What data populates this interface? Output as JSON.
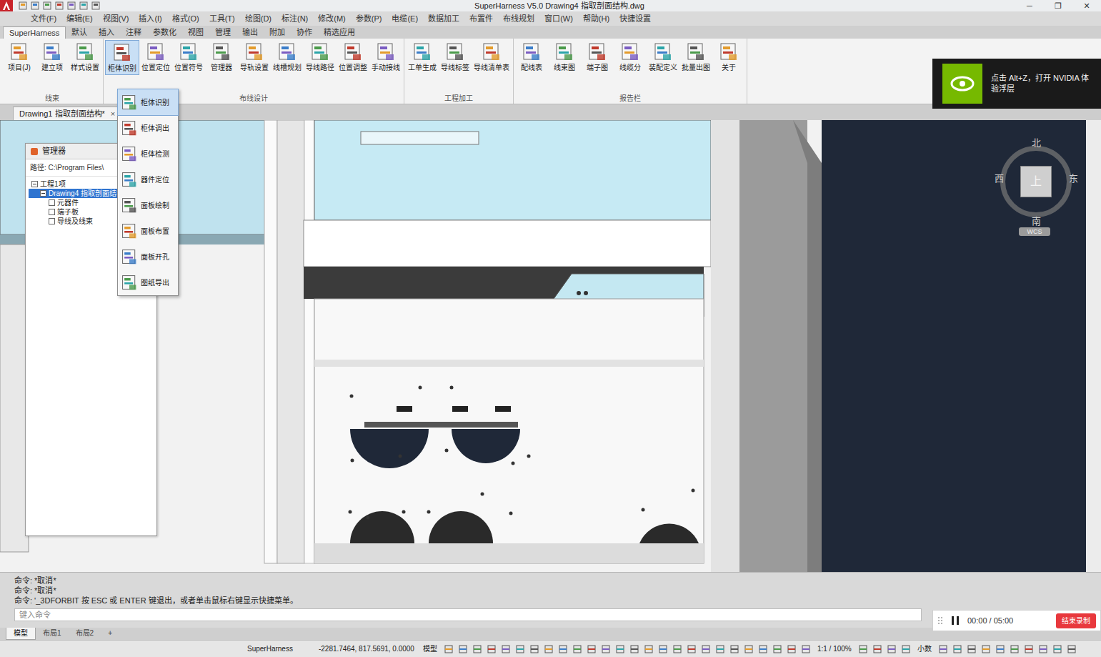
{
  "window": {
    "title": "SuperHarness V5.0   Drawing4 指取剖面结构.dwg",
    "controls": [
      "─",
      "❐",
      "✕"
    ]
  },
  "menu_bar": [
    "文件(F)",
    "编辑(E)",
    "视图(V)",
    "插入(I)",
    "格式(O)",
    "工具(T)",
    "绘图(D)",
    "标注(N)",
    "修改(M)",
    "参数(P)",
    "电缆(E)",
    "数据加工",
    "布置件",
    "布线规划",
    "窗口(W)",
    "帮助(H)",
    "快捷设置"
  ],
  "ribbon_tabs": [
    {
      "label": "SuperHarness",
      "selected": true
    },
    {
      "label": "默认",
      "selected": false
    },
    {
      "label": "插入",
      "selected": false
    },
    {
      "label": "注释",
      "selected": false
    },
    {
      "label": "参数化",
      "selected": false
    },
    {
      "label": "视图",
      "selected": false
    },
    {
      "label": "管理",
      "selected": false
    },
    {
      "label": "输出",
      "selected": false
    },
    {
      "label": "附加",
      "selected": false
    },
    {
      "label": "协作",
      "selected": false
    },
    {
      "label": "精选应用",
      "selected": false
    }
  ],
  "ribbon_groups": [
    {
      "label": "线束",
      "buttons": [
        {
          "label": "项目(J)",
          "selected": false
        },
        {
          "label": "建立项",
          "selected": false
        },
        {
          "label": "样式设置",
          "selected": false
        }
      ]
    },
    {
      "label": "布线设计",
      "buttons": [
        {
          "label": "柜体识别",
          "selected": true
        },
        {
          "label": "位置定位",
          "selected": false
        },
        {
          "label": "位置符号",
          "selected": false
        },
        {
          "label": "管理器",
          "selected": false
        },
        {
          "label": "导轨设置",
          "selected": false
        },
        {
          "label": "线槽规划",
          "selected": false
        },
        {
          "label": "导线路径",
          "selected": false
        },
        {
          "label": "位置调整",
          "selected": false
        },
        {
          "label": "手动接线",
          "selected": false
        }
      ]
    },
    {
      "label": "工程加工",
      "buttons": [
        {
          "label": "工单生成",
          "selected": false
        },
        {
          "label": "导线标签",
          "selected": false
        },
        {
          "label": "导线清单表",
          "selected": false
        }
      ]
    },
    {
      "label": "报告栏",
      "buttons": [
        {
          "label": "配线表",
          "selected": false
        },
        {
          "label": "线束图",
          "selected": false
        },
        {
          "label": "端子图",
          "selected": false
        },
        {
          "label": "线缆分",
          "selected": false
        },
        {
          "label": "装配定义",
          "selected": false
        },
        {
          "label": "批量出图",
          "selected": false
        },
        {
          "label": "关于",
          "selected": false
        }
      ]
    }
  ],
  "dropdown": [
    {
      "label": "柜体识别",
      "selected": true
    },
    {
      "label": "柜体调出",
      "selected": false
    },
    {
      "label": "柜体检测",
      "selected": false
    },
    {
      "label": "器件定位",
      "selected": false
    },
    {
      "label": "面板绘制",
      "selected": false
    },
    {
      "label": "面板布置",
      "selected": false
    },
    {
      "label": "面板开孔",
      "selected": false
    },
    {
      "label": "图纸导出",
      "selected": false
    }
  ],
  "notification": {
    "text": "点击 Alt+Z，打开 NVIDIA 体验浮层"
  },
  "document_tabs": [
    {
      "label": "Drawing1 指取剖面结构*",
      "selected": true,
      "close": "×"
    }
  ],
  "side_panel": {
    "title": "管理器",
    "path": "路径: C:\\Program Files\\",
    "tree": [
      {
        "label": "工程1项",
        "level": 0,
        "expanded": true,
        "selected": false
      },
      {
        "label": "Drawing4 指取剖面结构*",
        "level": 1,
        "expanded": true,
        "selected": true
      },
      {
        "label": "元器件",
        "level": 2,
        "expanded": false,
        "selected": false
      },
      {
        "label": "端子板",
        "level": 2,
        "expanded": false,
        "selected": false
      },
      {
        "label": "导线及线束",
        "level": 2,
        "expanded": false,
        "selected": false
      }
    ]
  },
  "view_cube": {
    "top": "上",
    "north": "北",
    "south": "南",
    "east": "东",
    "west": "西",
    "wcs": "WCS"
  },
  "command_history": [
    "命令: *取消*",
    "命令: *取消*",
    "命令: '_3DFORBIT 按 ESC 或 ENTER 键退出，或者单击鼠标右键显示快捷菜单。"
  ],
  "command_input": {
    "placeholder": "键入命令"
  },
  "recorder": {
    "time": "00:00 / 05:00",
    "button": "结束录制"
  },
  "layout_tabs": [
    {
      "label": "模型",
      "selected": true
    },
    {
      "label": "布局1",
      "selected": false
    },
    {
      "label": "布局2",
      "selected": false
    },
    {
      "label": "+",
      "selected": false
    }
  ],
  "status_bar": {
    "app": "SuperHarness",
    "coords": "-2281.7464, 817.5691, 0.0000",
    "mode": "模型",
    "scale": "1:1 / 100%",
    "units": "小数"
  }
}
